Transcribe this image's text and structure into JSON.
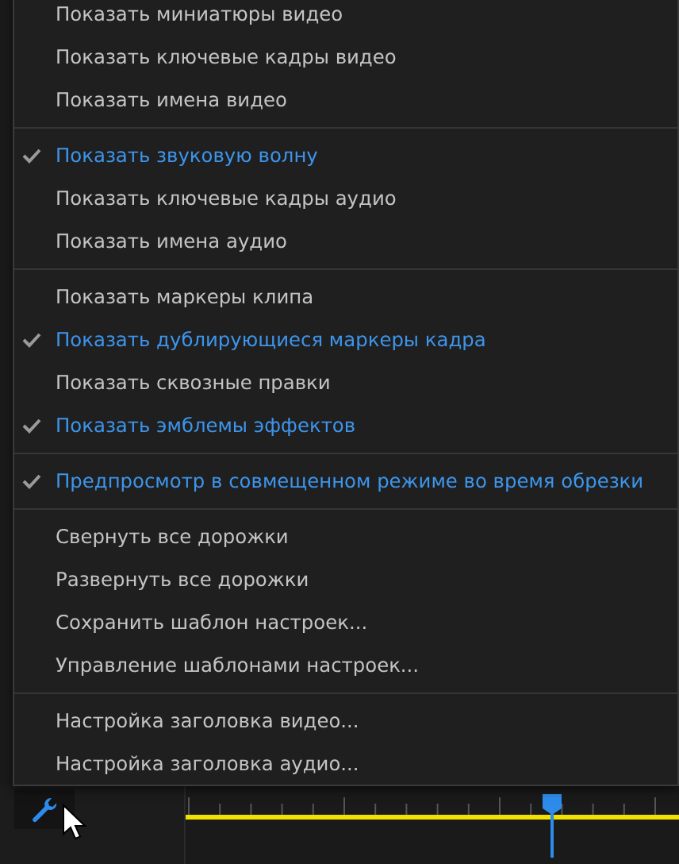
{
  "menu": {
    "groups": [
      {
        "items": [
          {
            "label": "Показать миниатюры видео",
            "checked": false
          },
          {
            "label": "Показать ключевые кадры видео",
            "checked": false
          },
          {
            "label": "Показать имена видео",
            "checked": false
          }
        ]
      },
      {
        "items": [
          {
            "label": "Показать звуковую волну",
            "checked": true
          },
          {
            "label": "Показать ключевые кадры аудио",
            "checked": false
          },
          {
            "label": "Показать имена аудио",
            "checked": false
          }
        ]
      },
      {
        "items": [
          {
            "label": "Показать маркеры клипа",
            "checked": false
          },
          {
            "label": "Показать дублирующиеся маркеры кадра",
            "checked": true
          },
          {
            "label": "Показать сквозные правки",
            "checked": false
          },
          {
            "label": "Показать эмблемы эффектов",
            "checked": true
          }
        ]
      },
      {
        "items": [
          {
            "label": "Предпросмотр в совмещенном режиме во время обрезки",
            "checked": true
          }
        ]
      },
      {
        "items": [
          {
            "label": "Свернуть все дорожки",
            "checked": false
          },
          {
            "label": "Развернуть все дорожки",
            "checked": false
          },
          {
            "label": "Сохранить шаблон настроек...",
            "checked": false
          },
          {
            "label": "Управление шаблонами настроек...",
            "checked": false
          }
        ]
      },
      {
        "items": [
          {
            "label": "Настройка заголовка видео...",
            "checked": false
          },
          {
            "label": "Настройка заголовка аудио...",
            "checked": false
          }
        ]
      }
    ]
  }
}
